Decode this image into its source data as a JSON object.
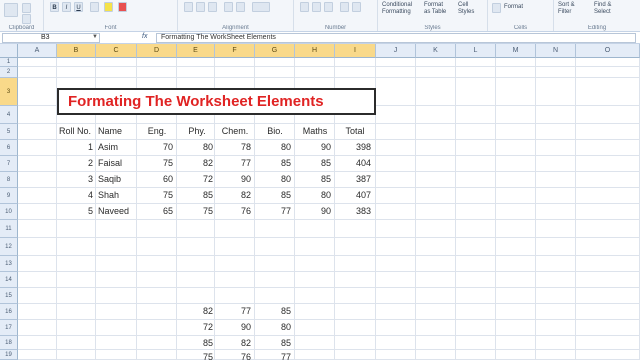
{
  "ribbon": {
    "groups": [
      {
        "label": "Clipboard"
      },
      {
        "label": "Font"
      },
      {
        "label": "Alignment"
      },
      {
        "label": "Number"
      },
      {
        "label": "Styles"
      },
      {
        "label": "Cells"
      },
      {
        "label": "Editing"
      }
    ],
    "styles_items": [
      "Conditional",
      "Format",
      "Cell"
    ],
    "styles_items2": [
      "Formatting",
      "as Table",
      "Styles"
    ],
    "cells_items": [
      "Format"
    ],
    "editing_items": [
      "Sort &",
      "Find &"
    ],
    "editing_items2": [
      "Filter",
      "Select"
    ]
  },
  "formula_bar": {
    "name_box": "B3",
    "fx": "fx",
    "formula": "Formatting The WorkSheet Elements"
  },
  "columns": [
    "A",
    "B",
    "C",
    "D",
    "E",
    "F",
    "G",
    "H",
    "I",
    "J",
    "K",
    "L",
    "M",
    "N",
    "O"
  ],
  "rows": [
    "1",
    "2",
    "3",
    "4",
    "5",
    "6",
    "7",
    "8",
    "9",
    "10",
    "11",
    "12",
    "13",
    "14",
    "15",
    "16",
    "17",
    "18",
    "19"
  ],
  "title": "Formating The Worksheet Elements",
  "table": {
    "headers": [
      "Roll No.",
      "Name",
      "Eng.",
      "Phy.",
      "Chem.",
      "Bio.",
      "Maths",
      "Total"
    ],
    "rows": [
      [
        "1",
        "Asim",
        "70",
        "80",
        "78",
        "80",
        "90",
        "398"
      ],
      [
        "2",
        "Faisal",
        "75",
        "82",
        "77",
        "85",
        "85",
        "404"
      ],
      [
        "3",
        "Saqib",
        "60",
        "72",
        "90",
        "80",
        "85",
        "387"
      ],
      [
        "4",
        "Shah",
        "75",
        "85",
        "82",
        "85",
        "80",
        "407"
      ],
      [
        "5",
        "Naveed",
        "65",
        "75",
        "76",
        "77",
        "90",
        "383"
      ]
    ]
  },
  "extra_block": [
    [
      "82",
      "77",
      "85"
    ],
    [
      "72",
      "90",
      "80"
    ],
    [
      "85",
      "82",
      "85"
    ],
    [
      "75",
      "76",
      "77"
    ]
  ]
}
